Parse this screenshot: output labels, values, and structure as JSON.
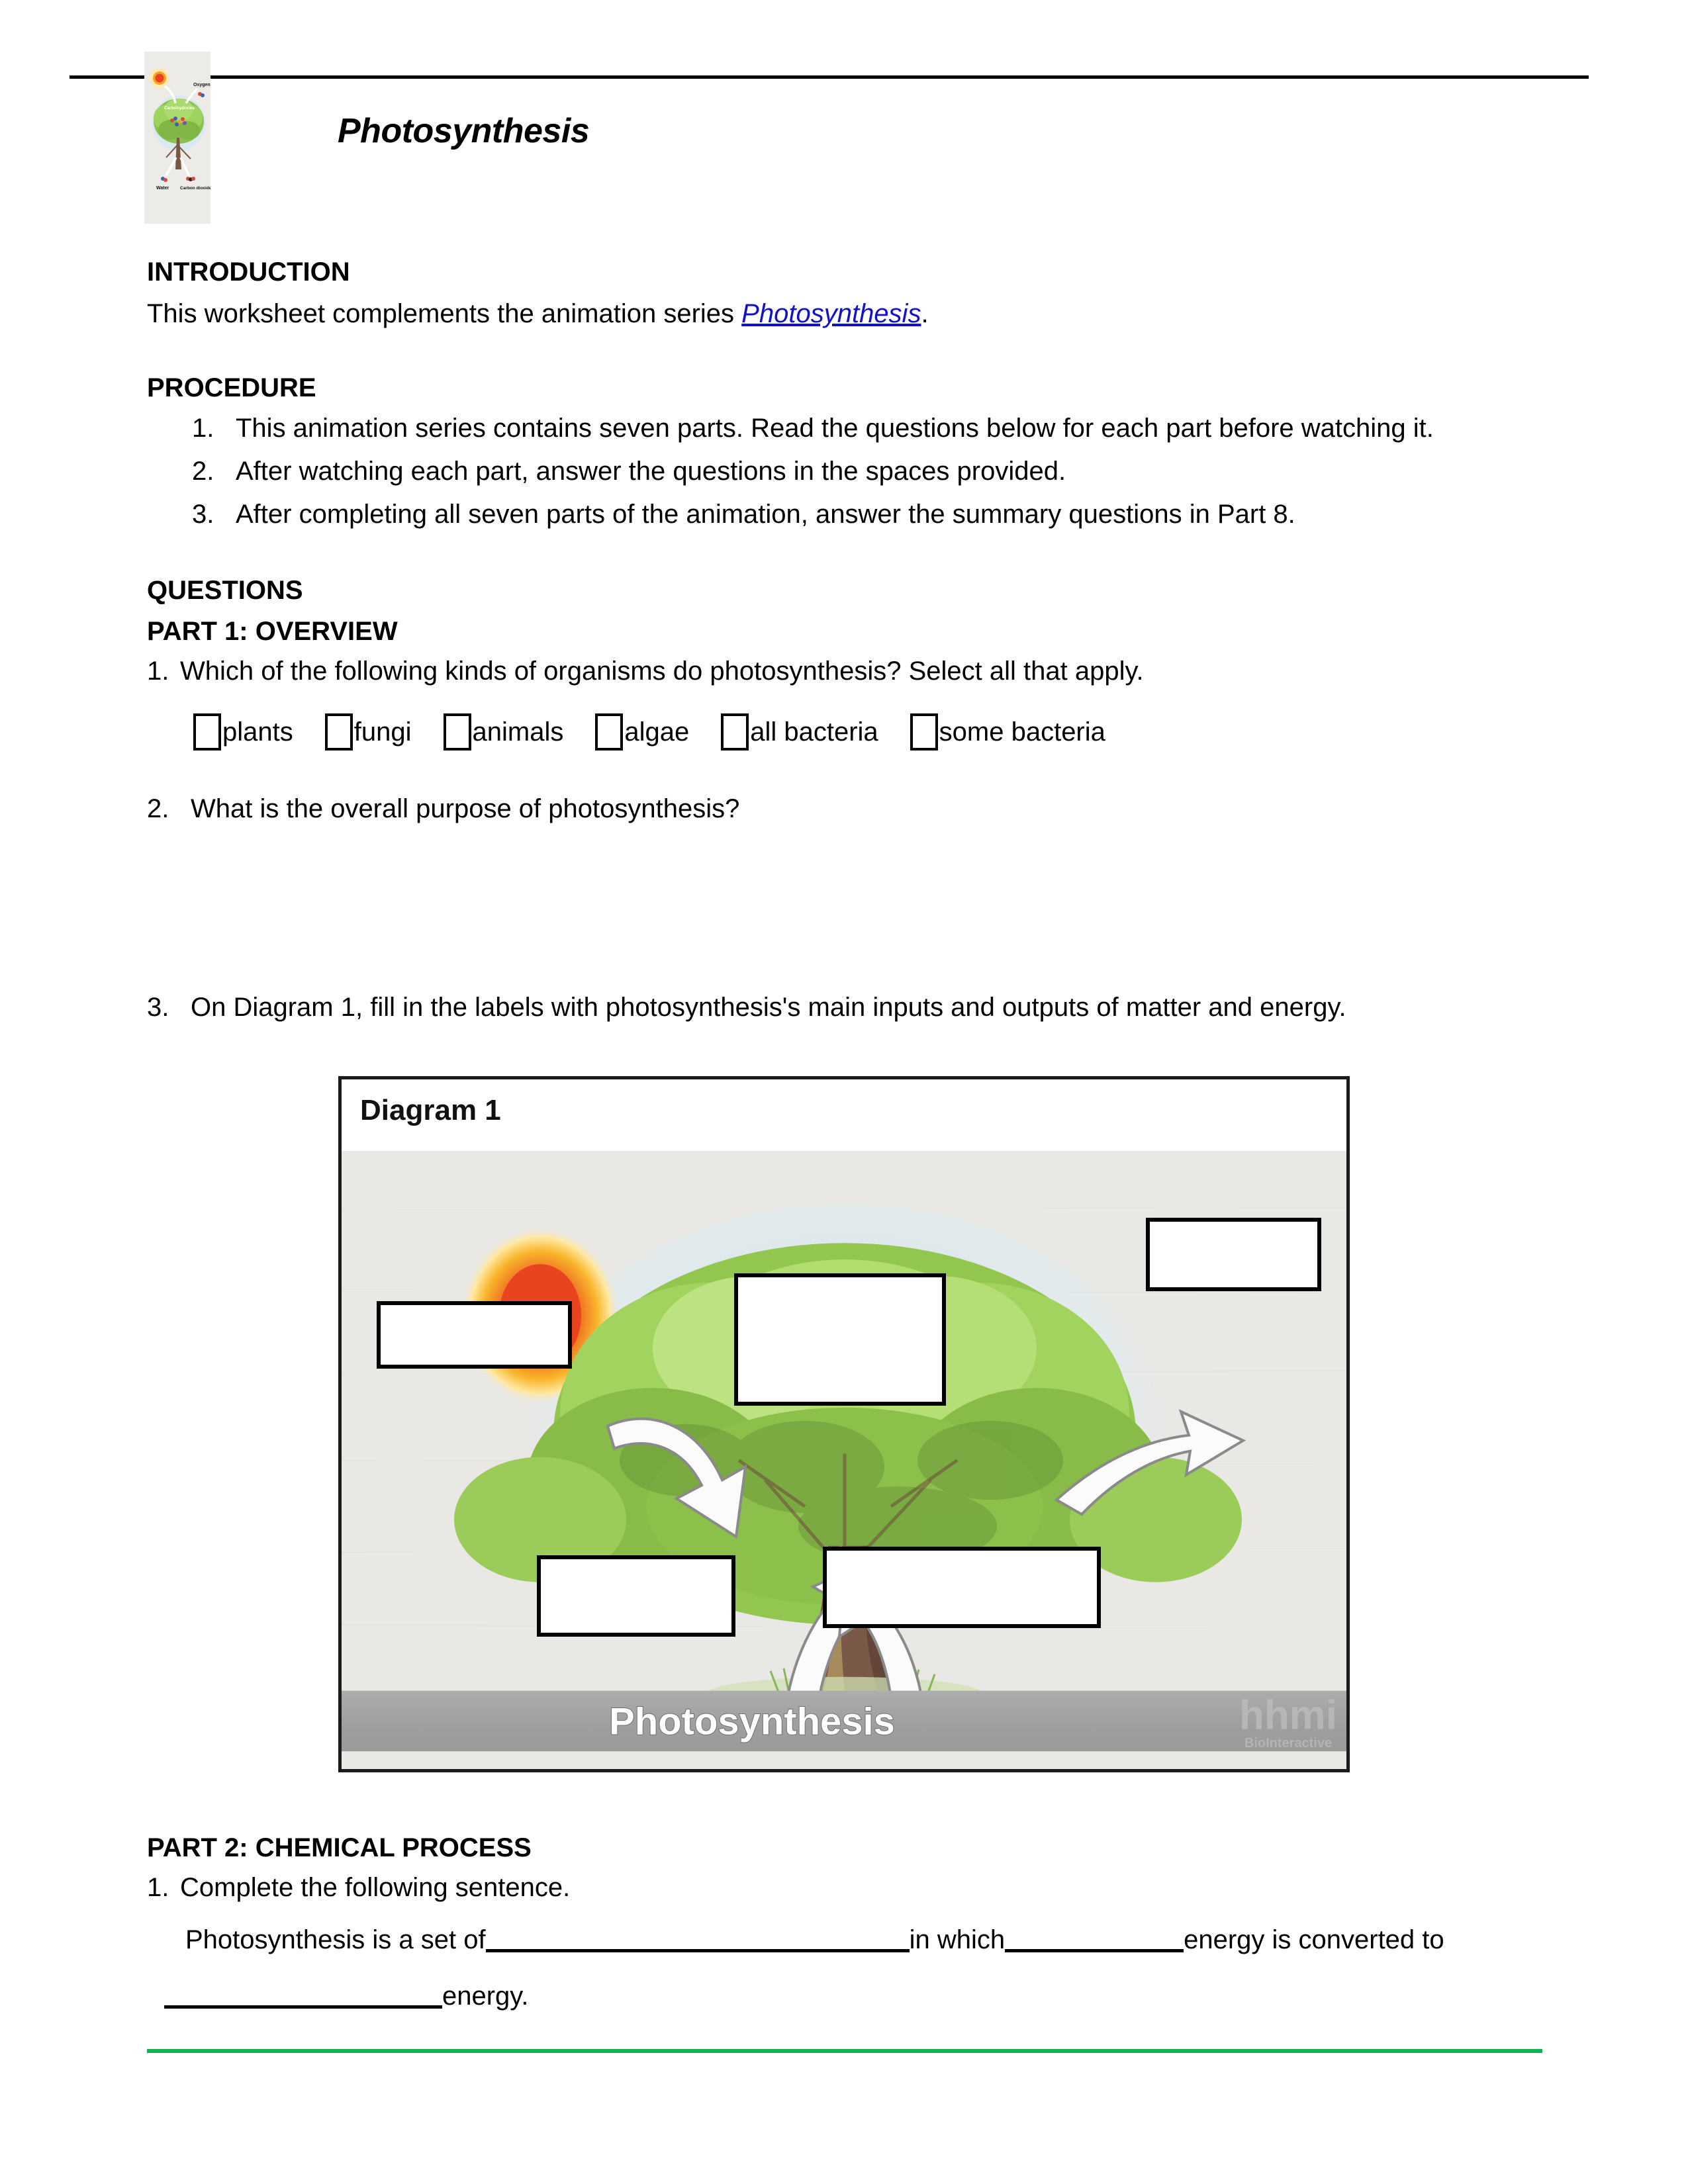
{
  "document": {
    "title": "Photosynthesis",
    "header_image": {
      "alt": "photosynthesis-tree-diagram",
      "labels": [
        "Oxygen",
        "Carbohydrates",
        "Water",
        "Carbon dioxide"
      ]
    }
  },
  "introduction": {
    "heading": "INTRODUCTION",
    "text_before_link": "This worksheet complements the animation series ",
    "link_text": "Photosynthesis",
    "text_after_link": "."
  },
  "procedure": {
    "heading": "PROCEDURE",
    "steps": [
      {
        "num": "1.",
        "text": "This animation series contains seven parts. Read the questions below for each part before watching it."
      },
      {
        "num": "2.",
        "text": "After watching each part, answer the questions in the spaces provided."
      },
      {
        "num": "3.",
        "text": "After completing all seven parts of the animation, answer the summary questions in Part 8."
      }
    ]
  },
  "questions": {
    "heading": "QUESTIONS",
    "part1": {
      "heading": "PART 1: OVERVIEW",
      "q1": {
        "num": "1.",
        "text": "Which of the following kinds of organisms do photosynthesis? Select all that apply.",
        "options": [
          "plants",
          "fungi",
          "animals",
          "algae",
          "all bacteria",
          "some bacteria"
        ]
      },
      "q2": {
        "num": "2.",
        "text": "What is the overall purpose of photosynthesis?"
      },
      "q3": {
        "num": "3.",
        "text": "On Diagram 1, fill in the labels with photosynthesis's main inputs and outputs of matter and energy."
      }
    },
    "part2": {
      "heading": "PART 2: CHEMICAL PROCESS",
      "q1": {
        "num": "1.",
        "text": "Complete the following sentence."
      },
      "sentence": {
        "seg1": "Photosynthesis is a set of",
        "seg2": "in which",
        "seg3": "energy is converted to",
        "seg4": "energy."
      }
    }
  },
  "diagram1": {
    "title": "Diagram 1",
    "caption": "Photosynthesis",
    "logo": "hhmi",
    "logo_subtitle": "BioInteractive",
    "label_boxes": [
      {
        "name": "sunlight-label-box"
      },
      {
        "name": "carbohydrates-label-box"
      },
      {
        "name": "oxygen-label-box"
      },
      {
        "name": "water-label-box"
      },
      {
        "name": "carbon-dioxide-label-box"
      }
    ]
  },
  "colors": {
    "link": "#1111cc",
    "footer_rule": "#13b054",
    "diagram_border": "#1b1b1b",
    "banner": "#a3a3a3"
  }
}
